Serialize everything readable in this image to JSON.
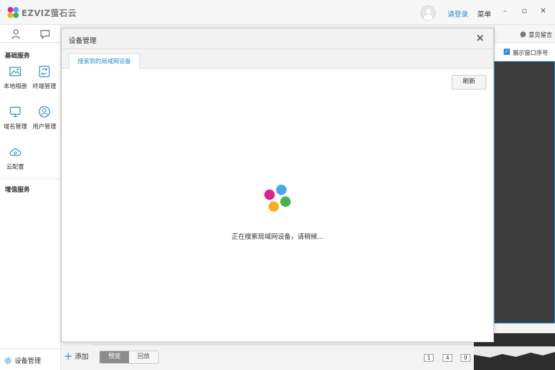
{
  "app": {
    "brand": "EZVIZ萤石云",
    "login_link": "请登录",
    "menu_label": "菜单",
    "window_controls": {
      "minimize": "–",
      "maximize": "▫",
      "close": "✕"
    }
  },
  "sidebar": {
    "sections": {
      "basic": "基础服务",
      "value_added": "增值服务"
    },
    "tiles": [
      {
        "label": "本地相册",
        "icon": "photo-album-icon"
      },
      {
        "label": "终端管理",
        "icon": "terminal-sync-icon"
      },
      {
        "label": "域名管理",
        "icon": "monitor-icon"
      },
      {
        "label": "用户管理",
        "icon": "user-icon"
      },
      {
        "label": "云配置",
        "icon": "cloud-config-icon"
      }
    ],
    "footer": {
      "device_manager": "设备管理",
      "add": "添加"
    }
  },
  "right_panel": {
    "feedback": "意见留言",
    "show_window_index": "展示窗口序号",
    "show_window_index_checked": true
  },
  "bottom_bar": {
    "preview": "预览",
    "playback": "回放",
    "grid_options": [
      "1",
      "4",
      "9"
    ]
  },
  "dialog": {
    "title": "设备管理",
    "close": "✕",
    "tab_label": "搜索到的局域网设备",
    "refresh_label": "刷新",
    "status_text": "正在搜索局域网设备，请稍候..."
  },
  "colors": {
    "accent": "#2a8fd8",
    "loader_pink": "#e0208a",
    "loader_blue": "#4aa8ea",
    "loader_green": "#45b24a",
    "loader_yellow": "#f5b01b"
  }
}
